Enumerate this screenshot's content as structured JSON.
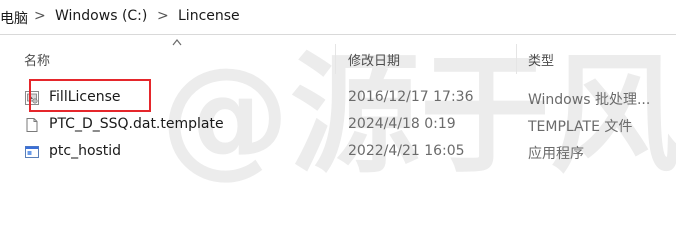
{
  "breadcrumb": {
    "items": [
      "电脑",
      "Windows (C:)",
      "Lincense"
    ],
    "separator": ">"
  },
  "columns": {
    "name": "名称",
    "date": "修改日期",
    "type": "类型"
  },
  "files": [
    {
      "name": "FillLicense",
      "date": "2016/12/17 17:36",
      "type": "Windows 批处理...",
      "icon": "batch-file-icon"
    },
    {
      "name": "PTC_D_SSQ.dat.template",
      "date": "2024/4/18 0:19",
      "type": "TEMPLATE 文件",
      "icon": "blank-file-icon"
    },
    {
      "name": "ptc_hostid",
      "date": "2022/4/21 16:05",
      "type": "应用程序",
      "icon": "application-icon"
    }
  ],
  "watermark_text": "@源于风",
  "colors": {
    "highlight": "#e5262b",
    "watermark": "#e9e9e9"
  }
}
